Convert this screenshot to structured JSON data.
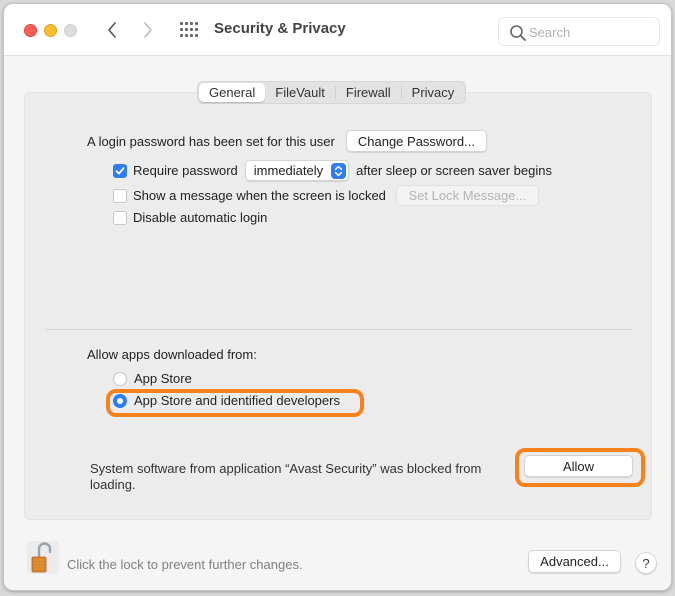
{
  "window": {
    "title": "Security & Privacy",
    "search_placeholder": "Search"
  },
  "tabs": [
    {
      "label": "General",
      "active": true
    },
    {
      "label": "FileVault",
      "active": false
    },
    {
      "label": "Firewall",
      "active": false
    },
    {
      "label": "Privacy",
      "active": false
    }
  ],
  "general": {
    "login_password_text": "A login password has been set for this user",
    "change_password_label": "Change Password...",
    "require_password_label": "Require password",
    "require_password_checked": true,
    "require_password_delay": "immediately",
    "require_password_suffix": "after sleep or screen saver begins",
    "show_message_label": "Show a message when the screen is locked",
    "show_message_checked": false,
    "set_lock_message_label": "Set Lock Message...",
    "disable_auto_login_label": "Disable automatic login",
    "disable_auto_login_checked": false
  },
  "allow_apps": {
    "heading": "Allow apps downloaded from:",
    "options": [
      {
        "label": "App Store",
        "selected": false
      },
      {
        "label": "App Store and identified developers",
        "selected": true
      }
    ]
  },
  "blocked": {
    "message": "System software from application “Avast Security” was blocked from loading.",
    "allow_label": "Allow"
  },
  "footer": {
    "lock_text": "Click the lock to prevent further changes.",
    "advanced_label": "Advanced...",
    "help_label": "?"
  },
  "colors": {
    "accent": "#2e7cf6",
    "highlight": "#f7821b"
  }
}
